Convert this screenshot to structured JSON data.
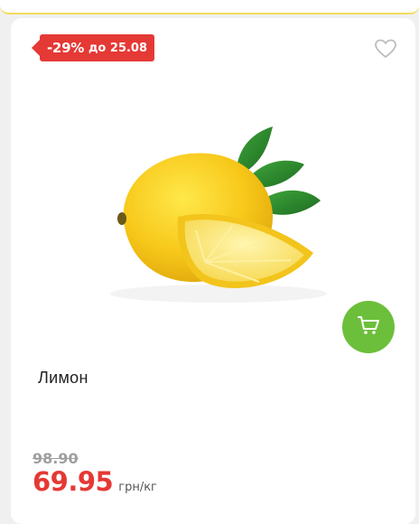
{
  "promo": {
    "discount": "-29%",
    "until": "до 25.08"
  },
  "product": {
    "name": "Лимон",
    "old_price": "98.90",
    "new_price": "69.95",
    "unit": "грн/кг"
  },
  "icons": {
    "favorite": "heart-icon",
    "cart": "cart-icon"
  },
  "colors": {
    "sale_red": "#e53935",
    "cart_green": "#6cbf3a",
    "accent_yellow": "#f3dc5a"
  }
}
